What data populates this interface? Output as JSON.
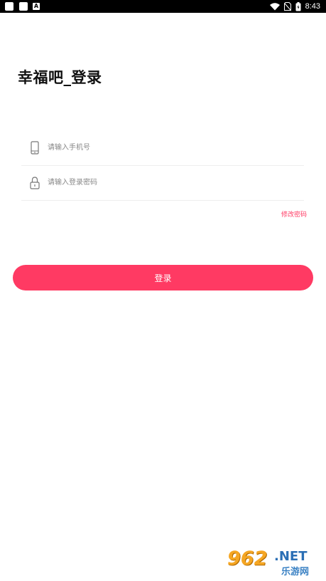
{
  "status_bar": {
    "time": "8:43",
    "left_icons": [
      "notification-icon",
      "notification-icon",
      "app-icon"
    ],
    "app_icon_glyph": "A",
    "right_icons": [
      "wifi-icon",
      "no-sim-icon",
      "battery-icon"
    ]
  },
  "page": {
    "title": "幸福吧_登录"
  },
  "form": {
    "phone": {
      "icon": "phone-icon",
      "placeholder": "请输入手机号",
      "value": ""
    },
    "password": {
      "icon": "lock-icon",
      "placeholder": "请输入登录密码",
      "value": ""
    },
    "forgot_label": "修改密码",
    "login_label": "登录"
  },
  "watermark": {
    "number": "962",
    "domain": ".NET",
    "subtitle": "乐游网"
  },
  "colors": {
    "accent": "#ff3a63",
    "status_bar": "#000000",
    "background": "#ffffff"
  }
}
